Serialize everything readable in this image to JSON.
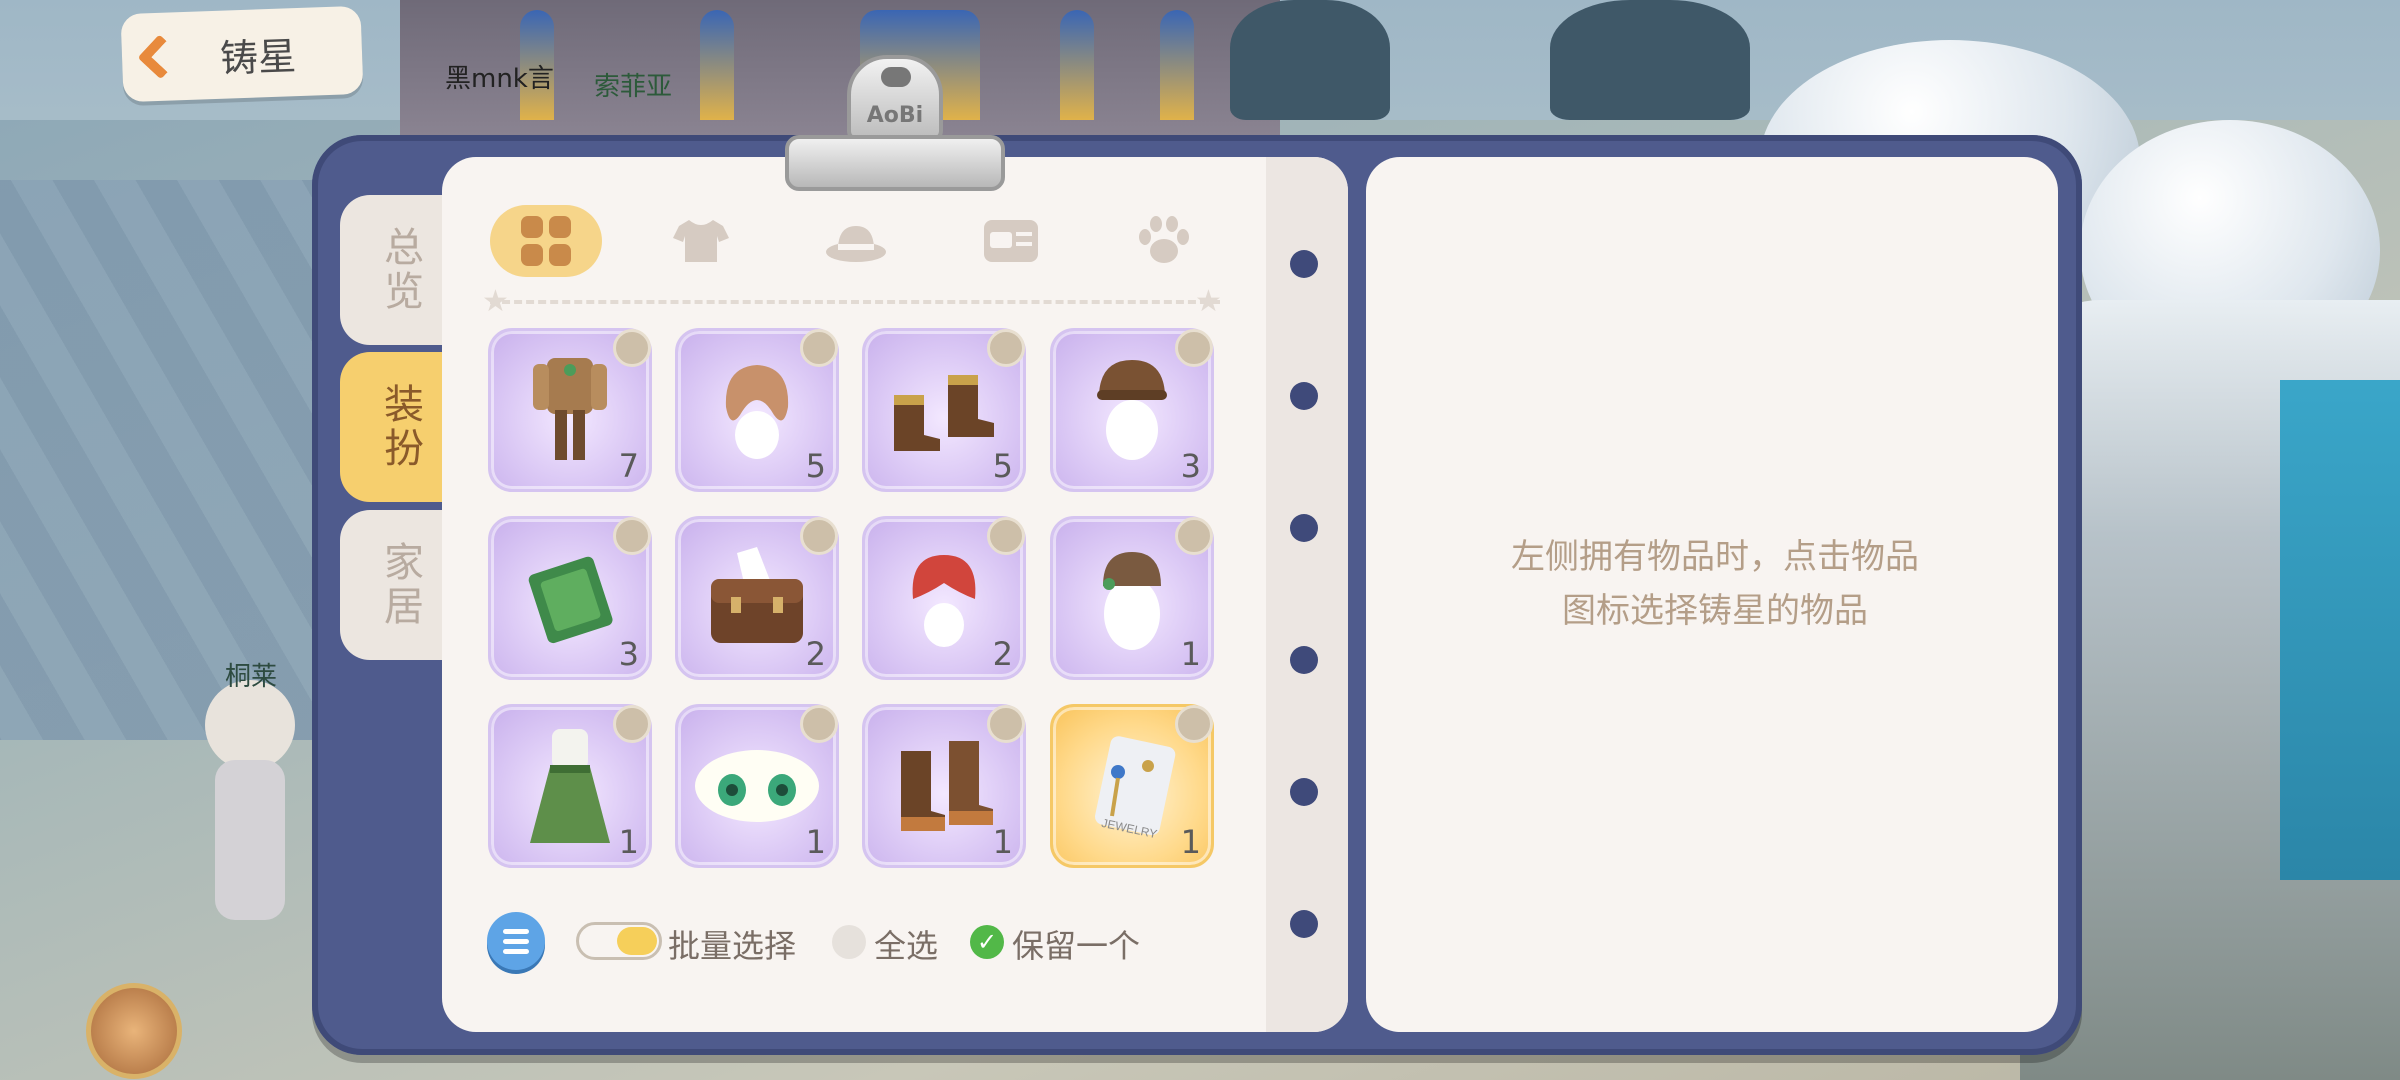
{
  "header": {
    "back_label": "铸星"
  },
  "scene": {
    "texts": [
      "黑mnk言",
      "索菲亚",
      "桐莱"
    ]
  },
  "clip_logo": "AoBi",
  "side_tabs": [
    {
      "label": "总览",
      "active": false
    },
    {
      "label": "装扮",
      "active": true
    },
    {
      "label": "家居",
      "active": false
    }
  ],
  "categories": [
    {
      "name": "all",
      "icon": "grid-icon",
      "active": true
    },
    {
      "name": "clothing",
      "icon": "shirt-icon",
      "active": false
    },
    {
      "name": "hat",
      "icon": "hat-icon",
      "active": false
    },
    {
      "name": "card",
      "icon": "card-icon",
      "active": false
    },
    {
      "name": "pet",
      "icon": "paw-icon",
      "active": false
    }
  ],
  "items": [
    {
      "name": "brown-outfit",
      "count": "7"
    },
    {
      "name": "wavy-hair",
      "count": "5"
    },
    {
      "name": "brown-boots",
      "count": "5"
    },
    {
      "name": "detective-hat",
      "count": "3"
    },
    {
      "name": "green-book",
      "count": "3"
    },
    {
      "name": "brown-satchel",
      "count": "2"
    },
    {
      "name": "red-hair",
      "count": "2"
    },
    {
      "name": "brown-cap",
      "count": "1"
    },
    {
      "name": "green-dress",
      "count": "1"
    },
    {
      "name": "green-eyes",
      "count": "1"
    },
    {
      "name": "tall-boots",
      "count": "1"
    },
    {
      "name": "jewelry-earrings",
      "count": "1",
      "rarity": "gold",
      "box_text": "JEWELRY"
    }
  ],
  "controls": {
    "batch_label": "批量选择",
    "select_all_label": "全选",
    "keep_one_label": "保留一个"
  },
  "hint": {
    "line1": "左侧拥有物品时，点击物品",
    "line2": "图标选择铸星的物品"
  },
  "colors": {
    "board": "#4f5b8d",
    "page": "#f8f4f1",
    "accent_gold": "#f6cf6e",
    "card_purple": "#d9c6f4",
    "check_green": "#52b848"
  }
}
